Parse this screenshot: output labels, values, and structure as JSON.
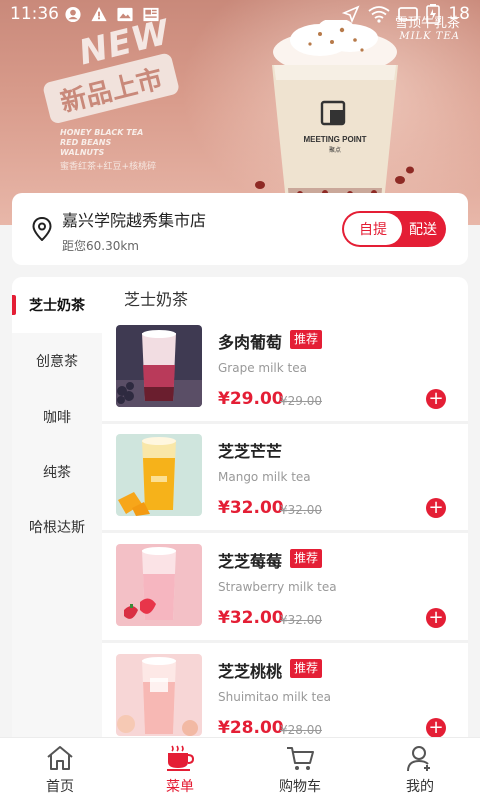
{
  "status_bar": {
    "time": "11:36",
    "battery": "18"
  },
  "banner": {
    "new_label": "NEW",
    "new_subtitle": "新品上市",
    "brand_cn": "雪顶牛乳茶",
    "brand_en": "MILK TEA",
    "cup_brand": "MEETING POINT",
    "cup_brand_cn": "聚点",
    "ingredients_en": [
      "HONEY BLACK TEA",
      "RED BEANS",
      "WALNUTS"
    ],
    "ingredients_cn": "蜜香红茶+红豆+核桃碎"
  },
  "store": {
    "name": "嘉兴学院越秀集市店",
    "distance": "距您60.30km",
    "mode_pickup": "自提",
    "mode_delivery": "配送"
  },
  "categories": [
    {
      "label": "芝士奶茶",
      "active": true
    },
    {
      "label": "创意茶",
      "active": false
    },
    {
      "label": "咖啡",
      "active": false
    },
    {
      "label": "纯茶",
      "active": false
    },
    {
      "label": "哈根达斯",
      "active": false
    }
  ],
  "section_title": "芝士奶茶",
  "products": [
    {
      "name": "多肉葡萄",
      "tag": "推荐",
      "en": "Grape milk tea",
      "price": "¥29.00",
      "old_price": "¥29.00"
    },
    {
      "name": "芝芝芒芒",
      "tag": "",
      "en": "Mango milk tea",
      "price": "¥32.00",
      "old_price": "¥32.00"
    },
    {
      "name": "芝芝莓莓",
      "tag": "推荐",
      "en": "Strawberry milk tea",
      "price": "¥32.00",
      "old_price": "¥32.00"
    },
    {
      "name": "芝芝桃桃",
      "tag": "推荐",
      "en": "Shuimitao milk tea",
      "price": "¥28.00",
      "old_price": "¥28.00"
    }
  ],
  "add_symbol": "+",
  "tabs": [
    {
      "label": "首页",
      "icon": "home-icon",
      "active": false
    },
    {
      "label": "菜单",
      "icon": "menu-cup-icon",
      "active": true
    },
    {
      "label": "购物车",
      "icon": "cart-icon",
      "active": false
    },
    {
      "label": "我的",
      "icon": "profile-icon",
      "active": false
    }
  ],
  "colors": {
    "accent": "#e41e35",
    "banner": "#d99c8c"
  }
}
